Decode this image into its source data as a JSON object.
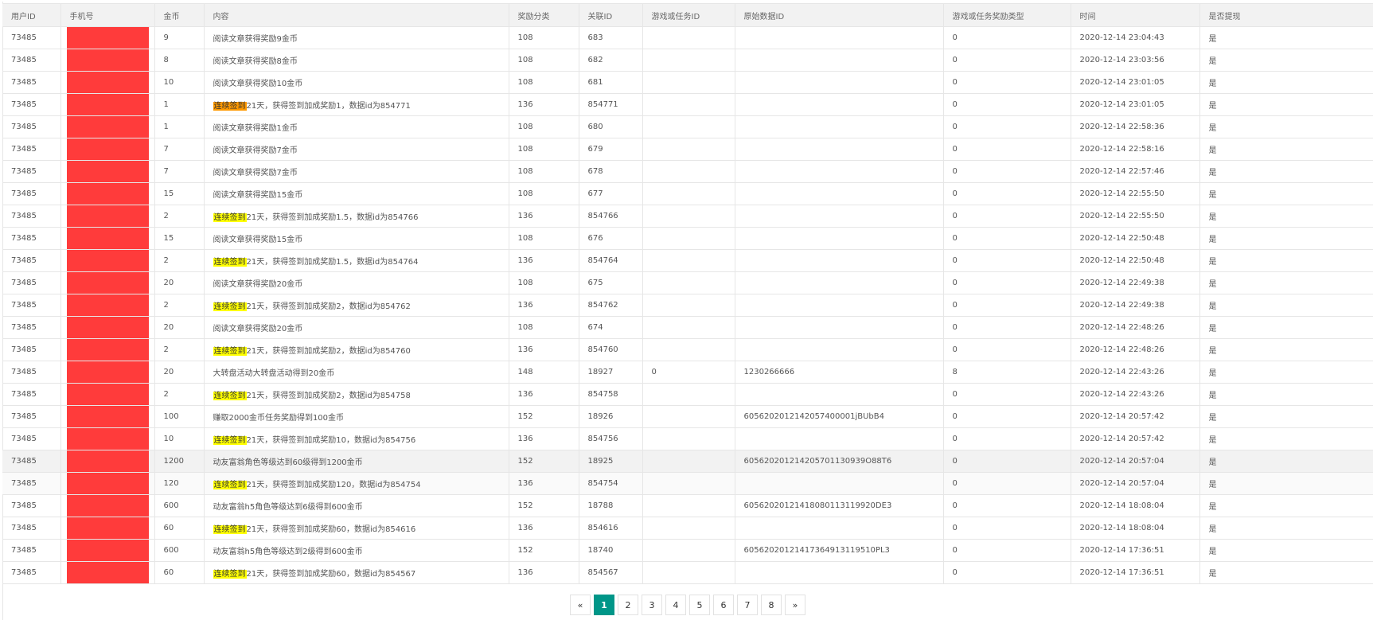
{
  "table": {
    "headers": [
      "用户ID",
      "手机号",
      "金币",
      "内容",
      "奖励分类",
      "关联ID",
      "游戏或任务ID",
      "原始数据ID",
      "游戏或任务奖励类型",
      "时间",
      "是否提现"
    ],
    "rows": [
      {
        "uid": "73485",
        "coins": "9",
        "content": "阅读文章获得奖励9金币",
        "category": "108",
        "rel_id": "683",
        "game_id": "",
        "raw_id": "",
        "reward_type": "0",
        "time": "2020-12-14 23:04:43",
        "withdrawn": "是"
      },
      {
        "uid": "73485",
        "coins": "8",
        "content": "阅读文章获得奖励8金币",
        "category": "108",
        "rel_id": "682",
        "game_id": "",
        "raw_id": "",
        "reward_type": "0",
        "time": "2020-12-14 23:03:56",
        "withdrawn": "是"
      },
      {
        "uid": "73485",
        "coins": "10",
        "content": "阅读文章获得奖励10金币",
        "category": "108",
        "rel_id": "681",
        "game_id": "",
        "raw_id": "",
        "reward_type": "0",
        "time": "2020-12-14 23:01:05",
        "withdrawn": "是"
      },
      {
        "uid": "73485",
        "coins": "1",
        "content_hl": "连续签到",
        "content": "21天，获得签到加成奖励1，数据id为854771",
        "hl_color": "orange",
        "category": "136",
        "rel_id": "854771",
        "game_id": "",
        "raw_id": "",
        "reward_type": "0",
        "time": "2020-12-14 23:01:05",
        "withdrawn": "是"
      },
      {
        "uid": "73485",
        "coins": "1",
        "content": "阅读文章获得奖励1金币",
        "category": "108",
        "rel_id": "680",
        "game_id": "",
        "raw_id": "",
        "reward_type": "0",
        "time": "2020-12-14 22:58:36",
        "withdrawn": "是"
      },
      {
        "uid": "73485",
        "coins": "7",
        "content": "阅读文章获得奖励7金币",
        "category": "108",
        "rel_id": "679",
        "game_id": "",
        "raw_id": "",
        "reward_type": "0",
        "time": "2020-12-14 22:58:16",
        "withdrawn": "是"
      },
      {
        "uid": "73485",
        "coins": "7",
        "content": "阅读文章获得奖励7金币",
        "category": "108",
        "rel_id": "678",
        "game_id": "",
        "raw_id": "",
        "reward_type": "0",
        "time": "2020-12-14 22:57:46",
        "withdrawn": "是"
      },
      {
        "uid": "73485",
        "coins": "15",
        "content": "阅读文章获得奖励15金币",
        "category": "108",
        "rel_id": "677",
        "game_id": "",
        "raw_id": "",
        "reward_type": "0",
        "time": "2020-12-14 22:55:50",
        "withdrawn": "是"
      },
      {
        "uid": "73485",
        "coins": "2",
        "content_hl": "连续签到",
        "content": "21天，获得签到加成奖励1.5，数据id为854766",
        "category": "136",
        "rel_id": "854766",
        "game_id": "",
        "raw_id": "",
        "reward_type": "0",
        "time": "2020-12-14 22:55:50",
        "withdrawn": "是"
      },
      {
        "uid": "73485",
        "coins": "15",
        "content": "阅读文章获得奖励15金币",
        "category": "108",
        "rel_id": "676",
        "game_id": "",
        "raw_id": "",
        "reward_type": "0",
        "time": "2020-12-14 22:50:48",
        "withdrawn": "是"
      },
      {
        "uid": "73485",
        "coins": "2",
        "content_hl": "连续签到",
        "content": "21天，获得签到加成奖励1.5，数据id为854764",
        "category": "136",
        "rel_id": "854764",
        "game_id": "",
        "raw_id": "",
        "reward_type": "0",
        "time": "2020-12-14 22:50:48",
        "withdrawn": "是"
      },
      {
        "uid": "73485",
        "coins": "20",
        "content": "阅读文章获得奖励20金币",
        "category": "108",
        "rel_id": "675",
        "game_id": "",
        "raw_id": "",
        "reward_type": "0",
        "time": "2020-12-14 22:49:38",
        "withdrawn": "是"
      },
      {
        "uid": "73485",
        "coins": "2",
        "content_hl": "连续签到",
        "content": "21天，获得签到加成奖励2，数据id为854762",
        "category": "136",
        "rel_id": "854762",
        "game_id": "",
        "raw_id": "",
        "reward_type": "0",
        "time": "2020-12-14 22:49:38",
        "withdrawn": "是"
      },
      {
        "uid": "73485",
        "coins": "20",
        "content": "阅读文章获得奖励20金币",
        "category": "108",
        "rel_id": "674",
        "game_id": "",
        "raw_id": "",
        "reward_type": "0",
        "time": "2020-12-14 22:48:26",
        "withdrawn": "是"
      },
      {
        "uid": "73485",
        "coins": "2",
        "content_hl": "连续签到",
        "content": "21天，获得签到加成奖励2，数据id为854760",
        "category": "136",
        "rel_id": "854760",
        "game_id": "",
        "raw_id": "",
        "reward_type": "0",
        "time": "2020-12-14 22:48:26",
        "withdrawn": "是"
      },
      {
        "uid": "73485",
        "coins": "20",
        "content": "大转盘活动大转盘活动得到20金币",
        "category": "148",
        "rel_id": "18927",
        "game_id": "0",
        "raw_id": "1230266666",
        "reward_type": "8",
        "time": "2020-12-14 22:43:26",
        "withdrawn": "是"
      },
      {
        "uid": "73485",
        "coins": "2",
        "content_hl": "连续签到",
        "content": "21天，获得签到加成奖励2，数据id为854758",
        "category": "136",
        "rel_id": "854758",
        "game_id": "",
        "raw_id": "",
        "reward_type": "0",
        "time": "2020-12-14 22:43:26",
        "withdrawn": "是"
      },
      {
        "uid": "73485",
        "coins": "100",
        "content": "赚取2000金币任务奖励得到100金币",
        "category": "152",
        "rel_id": "18926",
        "game_id": "",
        "raw_id": "60562020121420574000​01jBUbB4",
        "reward_type": "0",
        "time": "2020-12-14 20:57:42",
        "withdrawn": "是"
      },
      {
        "uid": "73485",
        "coins": "10",
        "content_hl": "连续签到",
        "content": "21天，获得签到加成奖励10，数据id为854756",
        "category": "136",
        "rel_id": "854756",
        "game_id": "",
        "raw_id": "",
        "reward_type": "0",
        "time": "2020-12-14 20:57:42",
        "withdrawn": "是"
      },
      {
        "uid": "73485",
        "coins": "1200",
        "content": "动友富翁角色等级达到60级得到1200金币",
        "category": "152",
        "rel_id": "18925",
        "game_id": "",
        "raw_id": "60562020121420570113093​9O88T6",
        "reward_type": "0",
        "time": "2020-12-14 20:57:04",
        "withdrawn": "是",
        "row_state": "hover"
      },
      {
        "uid": "73485",
        "coins": "120",
        "content_hl": "连续签到",
        "content": "21天，获得签到加成奖励120，数据id为854754",
        "category": "136",
        "rel_id": "854754",
        "game_id": "",
        "raw_id": "",
        "reward_type": "0",
        "time": "2020-12-14 20:57:04",
        "withdrawn": "是",
        "row_state": "hover2"
      },
      {
        "uid": "73485",
        "coins": "600",
        "content": "动友富翁h5角色等级达到6级得到600金币",
        "category": "152",
        "rel_id": "18788",
        "game_id": "",
        "raw_id": "60562020121418080113119920DE3",
        "reward_type": "0",
        "time": "2020-12-14 18:08:04",
        "withdrawn": "是"
      },
      {
        "uid": "73485",
        "coins": "60",
        "content_hl": "连续签到",
        "content": "21天，获得签到加成奖励60，数据id为854616",
        "category": "136",
        "rel_id": "854616",
        "game_id": "",
        "raw_id": "",
        "reward_type": "0",
        "time": "2020-12-14 18:08:04",
        "withdrawn": "是"
      },
      {
        "uid": "73485",
        "coins": "600",
        "content": "动友富翁h5角色等级达到2级得到600金币",
        "category": "152",
        "rel_id": "18740",
        "game_id": "",
        "raw_id": "60562020121417364913119510PL3",
        "reward_type": "0",
        "time": "2020-12-14 17:36:51",
        "withdrawn": "是"
      },
      {
        "uid": "73485",
        "coins": "60",
        "content_hl": "连续签到",
        "content": "21天，获得签到加成奖励60，数据id为854567",
        "category": "136",
        "rel_id": "854567",
        "game_id": "",
        "raw_id": "",
        "reward_type": "0",
        "time": "2020-12-14 17:36:51",
        "withdrawn": "是"
      }
    ]
  },
  "pagination": {
    "prev": "«",
    "next": "»",
    "pages": [
      "1",
      "2",
      "3",
      "4",
      "5",
      "6",
      "7",
      "8"
    ],
    "current": "1"
  },
  "colors": {
    "active_page": "#009688",
    "redaction": "#ff3b3b",
    "highlight_yellow": "#ffff00",
    "highlight_orange": "#ff9900"
  }
}
